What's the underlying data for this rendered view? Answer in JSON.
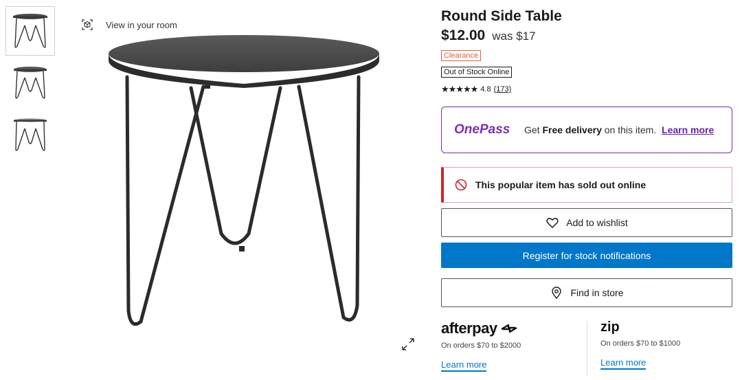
{
  "product": {
    "title": "Round Side Table",
    "price": "$12.00",
    "was_price": "was $17",
    "clearance_badge": "Clearance",
    "stock_badge": "Out of Stock Online",
    "rating": "4.8",
    "review_count": "(173)",
    "stars": "★★★★★"
  },
  "gallery": {
    "view_in_room": "View in your room",
    "thumbnail_count": 3
  },
  "onepass": {
    "logo": "OnePass",
    "text_prefix": "Get ",
    "text_bold": "Free delivery",
    "text_suffix": " on this item.",
    "link": "Learn more",
    "accent": "#7b2cbf"
  },
  "soldout": {
    "message": "This popular item has sold out online",
    "accent": "#d0222f"
  },
  "actions": {
    "wishlist": "Add to wishlist",
    "notify": "Register for stock notifications",
    "find_store": "Find in store",
    "primary_color": "#0077c8"
  },
  "payments": {
    "afterpay": {
      "logo": "afterpay",
      "sub": "On orders $70 to $2000",
      "link": "Learn more"
    },
    "zip": {
      "logo": "zip",
      "sub": "On orders $70 to $1000",
      "link": "Learn more"
    }
  }
}
